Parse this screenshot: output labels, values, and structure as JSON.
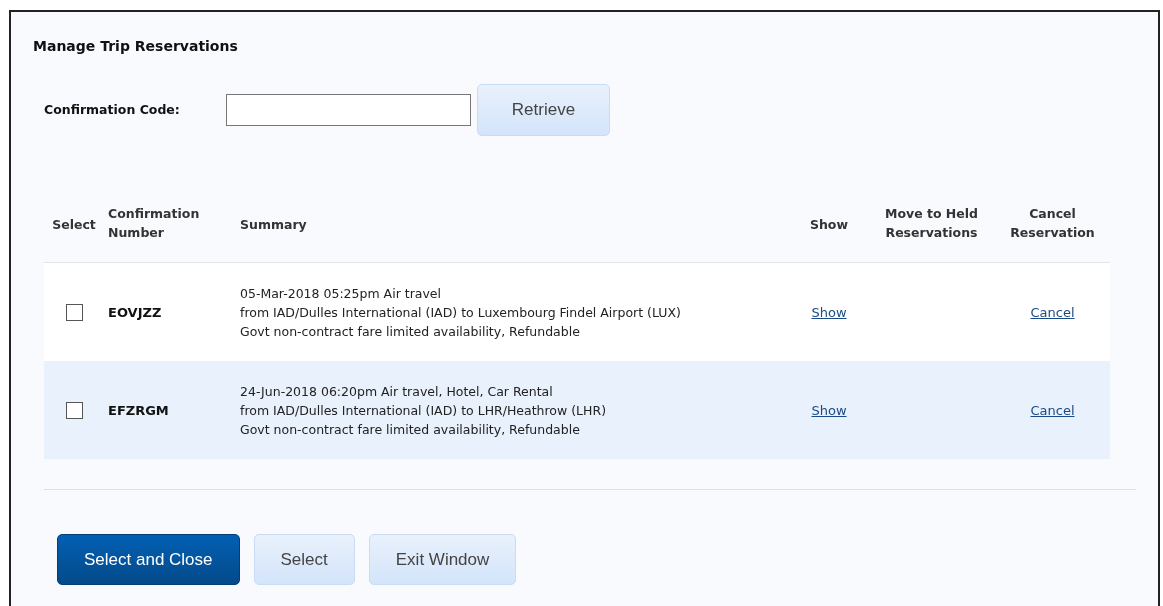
{
  "title": "Manage Trip Reservations",
  "lookup": {
    "label": "Confirmation Code:",
    "button": "Retrieve"
  },
  "table": {
    "columns": [
      "Select",
      "Confirmation Number",
      "Summary",
      "Show",
      "Move to Held Reservations",
      "Cancel Reservation"
    ],
    "rows": [
      {
        "checked": false,
        "number": "EOVJZZ",
        "summary": [
          "05-Mar-2018 05:25pm Air travel",
          "from IAD/Dulles International (IAD) to Luxembourg Findel Airport (LUX)",
          "Govt non-contract fare limited availability, Refundable"
        ],
        "show": "Show",
        "cancel": "Cancel"
      },
      {
        "checked": false,
        "number": "EFZRGM",
        "summary": [
          "24-Jun-2018 06:20pm Air travel, Hotel, Car Rental",
          "from IAD/Dulles International (IAD) to LHR/Heathrow (LHR)",
          "Govt non-contract fare limited availability, Refundable"
        ],
        "show": "Show",
        "cancel": "Cancel"
      }
    ]
  },
  "buttons": [
    {
      "label": "Select and Close",
      "kind": "primary"
    },
    {
      "label": "Select",
      "kind": "secondary"
    },
    {
      "label": "Exit Window",
      "kind": "secondary"
    }
  ]
}
